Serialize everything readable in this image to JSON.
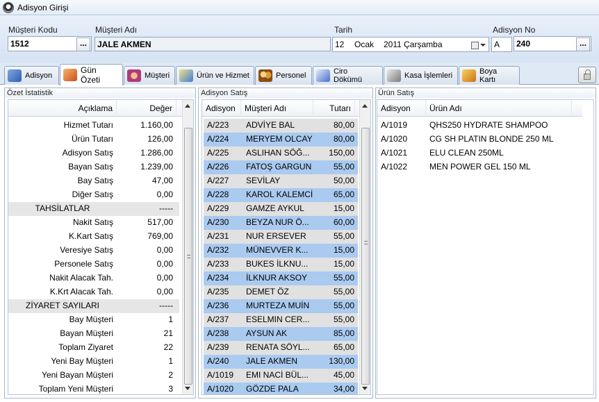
{
  "window": {
    "title": "Adisyon Girişi"
  },
  "header": {
    "musteri_kodu_label": "Müşteri Kodu",
    "musteri_kodu_value": "1512",
    "musteri_adi_label": "Müşteri Adı",
    "musteri_adi_value": "JALE AKMEN",
    "tarih_label": "Tarih",
    "tarih_day": "12",
    "tarih_month": "Ocak",
    "tarih_year_weekday": "2011 Çarşamba",
    "adisyon_no_label": "Adisyon No",
    "adisyon_prefix": "A",
    "adisyon_no_value": "240",
    "dots_label": "..."
  },
  "tabs": [
    {
      "label": "Adisyon",
      "icon": "receipt-icon",
      "color": "#4a79c4"
    },
    {
      "label": "Gün Özeti",
      "icon": "chart-icon",
      "color": "#e36b2c"
    },
    {
      "label": "Müşteri",
      "icon": "customer-icon",
      "color": "#d04a8a"
    },
    {
      "label": "Ürün ve Hizmet",
      "icon": "product-icon",
      "color": "#3e7dd6"
    },
    {
      "label": "Personel",
      "icon": "staff-icon",
      "color": "#d98a2b"
    },
    {
      "label": "Ciro Dökümü",
      "icon": "report-icon",
      "color": "#4a6fc8"
    },
    {
      "label": "Kasa İşlemleri",
      "icon": "register-icon",
      "color": "#8a8a8a"
    },
    {
      "label": "Boya Kartı",
      "icon": "paint-card-icon",
      "color": "#e0a020"
    }
  ],
  "active_tab": "Gün Özeti",
  "ozet": {
    "title": "Özet İstatistik",
    "col_aciklama": "Açıklama",
    "col_deger": "Değer",
    "rows": [
      {
        "label": "Hizmet Tutarı",
        "value": "1.160,00",
        "section": false
      },
      {
        "label": "Ürün Tutarı",
        "value": "126,00",
        "section": false
      },
      {
        "label": "Adisyon Satış",
        "value": "1.286,00",
        "section": false
      },
      {
        "label": "Bayan Satış",
        "value": "1.239,00",
        "section": false
      },
      {
        "label": "Bay Satış",
        "value": "47,00",
        "section": false
      },
      {
        "label": "Diğer Satış",
        "value": "0,00",
        "section": false
      },
      {
        "label": "TAHSİLATLAR",
        "value": "-----",
        "section": true
      },
      {
        "label": "Nakit Satış",
        "value": "517,00",
        "section": false
      },
      {
        "label": "K.Kart Satış",
        "value": "769,00",
        "section": false
      },
      {
        "label": "Veresiye Satış",
        "value": "0,00",
        "section": false
      },
      {
        "label": "Personele Satış",
        "value": "0,00",
        "section": false
      },
      {
        "label": "Nakit Alacak Tah.",
        "value": "0,00",
        "section": false
      },
      {
        "label": "K.Krt Alacak Tah.",
        "value": "0,00",
        "section": false
      },
      {
        "label": "ZİYARET SAYILARI",
        "value": "-----",
        "section": true
      },
      {
        "label": "Bay Müşteri",
        "value": "1",
        "section": false
      },
      {
        "label": "Bayan Müşteri",
        "value": "21",
        "section": false
      },
      {
        "label": "Toplam Ziyaret",
        "value": "22",
        "section": false
      },
      {
        "label": "Yeni Bay Müşteri",
        "value": "1",
        "section": false
      },
      {
        "label": "Yeni Bayan Müşteri",
        "value": "2",
        "section": false
      },
      {
        "label": "Toplam Yeni Müşteri",
        "value": "3",
        "section": false
      }
    ]
  },
  "satis": {
    "title": "Adisyon Satış",
    "col_adisyon": "Adisyon",
    "col_musteri": "Müşteri Adı",
    "col_tutar": "Tutarı",
    "rows": [
      {
        "adisyon": "A/223",
        "musteri": "ADVİYE BAL",
        "tutar": "80,00"
      },
      {
        "adisyon": "A/224",
        "musteri": "MERYEM OLCAY",
        "tutar": "80,00"
      },
      {
        "adisyon": "A/225",
        "musteri": "ASLIHAN SÖĞ...",
        "tutar": "150,00"
      },
      {
        "adisyon": "A/226",
        "musteri": "FATOŞ GARGUN",
        "tutar": "55,00"
      },
      {
        "adisyon": "A/227",
        "musteri": "SEVİLAY",
        "tutar": "50,00"
      },
      {
        "adisyon": "A/228",
        "musteri": "KAROL KALEMCİ",
        "tutar": "65,00"
      },
      {
        "adisyon": "A/229",
        "musteri": "GAMZE AYKUL",
        "tutar": "15,00"
      },
      {
        "adisyon": "A/230",
        "musteri": "BEYZA NUR Ö...",
        "tutar": "60,00"
      },
      {
        "adisyon": "A/231",
        "musteri": "NUR ERSEVER",
        "tutar": "55,00"
      },
      {
        "adisyon": "A/232",
        "musteri": "MÜNEVVER K...",
        "tutar": "15,00"
      },
      {
        "adisyon": "A/233",
        "musteri": "BUKES İLKNU...",
        "tutar": "15,00"
      },
      {
        "adisyon": "A/234",
        "musteri": "İLKNUR AKSOY",
        "tutar": "55,00"
      },
      {
        "adisyon": "A/235",
        "musteri": "DEMET ÖZ",
        "tutar": "55,00"
      },
      {
        "adisyon": "A/236",
        "musteri": "MURTEZA MUİN",
        "tutar": "55,00"
      },
      {
        "adisyon": "A/237",
        "musteri": "ESELMIN CER...",
        "tutar": "55,00"
      },
      {
        "adisyon": "A/238",
        "musteri": "AYSUN AK",
        "tutar": "85,00"
      },
      {
        "adisyon": "A/239",
        "musteri": "RENATA SÖYL...",
        "tutar": "65,00"
      },
      {
        "adisyon": "A/240",
        "musteri": "JALE AKMEN",
        "tutar": "130,00"
      },
      {
        "adisyon": "A/1019",
        "musteri": "EMI NACİ BÜL...",
        "tutar": "45,00"
      },
      {
        "adisyon": "A/1020",
        "musteri": "GÖZDE PALA",
        "tutar": "34,00"
      }
    ]
  },
  "urun": {
    "title": "Ürün Satış",
    "col_adisyon": "Adisyon",
    "col_urun": "Ürün Adı",
    "rows": [
      {
        "adisyon": "A/1019",
        "urun": "QHS250 HYDRATE SHAMPOO"
      },
      {
        "adisyon": "A/1020",
        "urun": "CG SH PLATIN BLONDE 250 ML"
      },
      {
        "adisyon": "A/1021",
        "urun": "ELU CLEAN 250ML"
      },
      {
        "adisyon": "A/1022",
        "urun": "MEN POWER GEL 150 ML"
      }
    ]
  },
  "colors": {
    "row_gray": "#e1e1e1",
    "row_blue": "#aacaf0",
    "section_bg": "#e6e6e6"
  }
}
